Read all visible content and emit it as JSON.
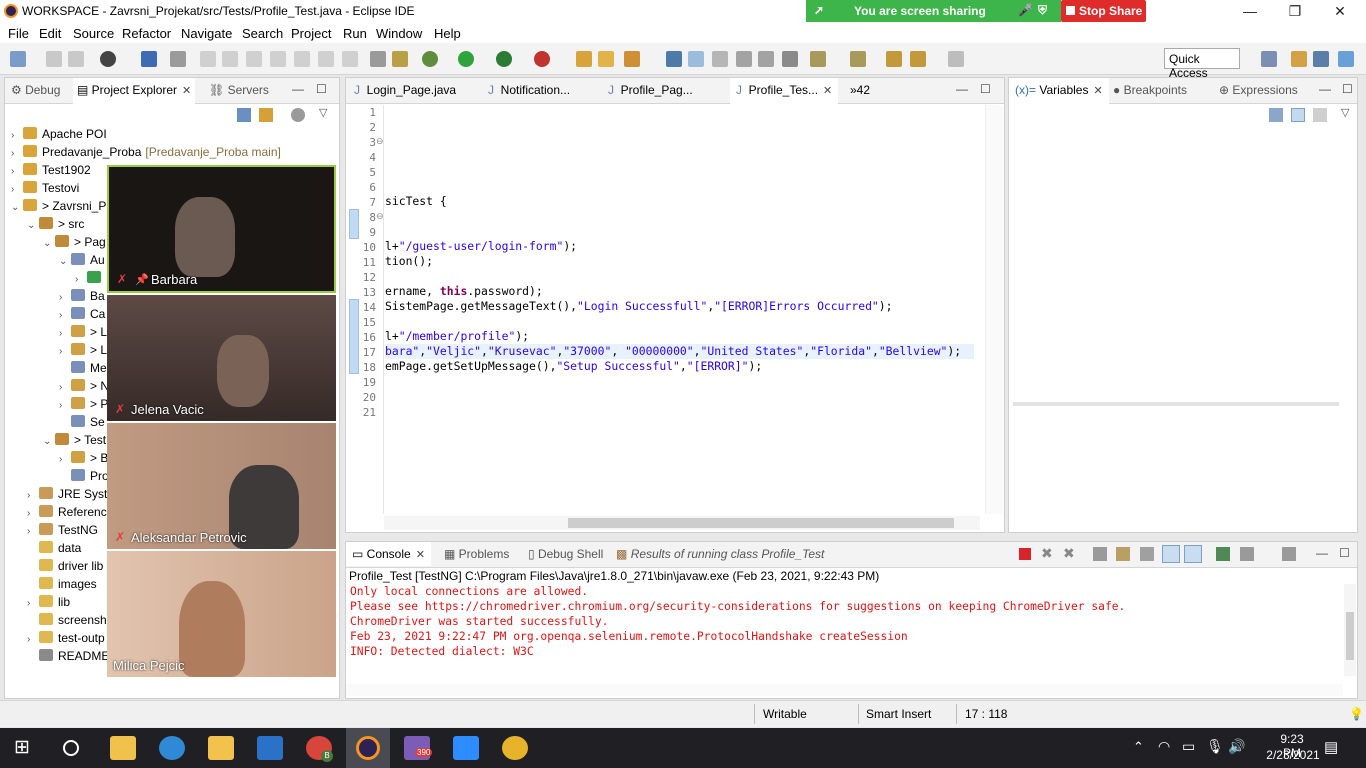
{
  "window": {
    "title": "WORKSPACE - Zavrsni_Projekat/src/Tests/Profile_Test.java - Eclipse IDE",
    "minimize": "—",
    "maximize": "❐",
    "close": "✕"
  },
  "screen_share": {
    "status": "You are screen sharing",
    "stop_label": "Stop Share",
    "color": "#3db54a",
    "stop_color": "#e02b2b"
  },
  "menu": [
    "File",
    "Edit",
    "Source",
    "Refactor",
    "Navigate",
    "Search",
    "Project",
    "Run",
    "Window",
    "Help"
  ],
  "toolbar": {
    "quick_access": "Quick Access"
  },
  "left_panel": {
    "tabs": [
      "Debug",
      "Project Explorer",
      "Servers"
    ],
    "active_tab": "Project Explorer",
    "tree": [
      {
        "label": "Apache POI",
        "arrow": "›",
        "branch": ""
      },
      {
        "label": "Predavanje_Proba",
        "arrow": "›",
        "branch": "[Predavanje_Proba main]"
      },
      {
        "label": "Test1902",
        "arrow": "›",
        "branch": ""
      },
      {
        "label": "Testovi",
        "arrow": "›",
        "branch": ""
      },
      {
        "label": "> Zavrsni_P",
        "arrow": "⌄",
        "branch": ""
      },
      {
        "label": "> src",
        "arrow": "⌄",
        "branch": ""
      },
      {
        "label": "> Pag",
        "arrow": "⌄",
        "branch": ""
      },
      {
        "label": "Au",
        "arrow": "⌄",
        "branch": ""
      },
      {
        "label": "",
        "arrow": "›",
        "branch": ""
      },
      {
        "label": "Ba",
        "arrow": "›",
        "branch": ""
      },
      {
        "label": "Ca",
        "arrow": "›",
        "branch": ""
      },
      {
        "label": "> L",
        "arrow": "›",
        "branch": ""
      },
      {
        "label": "> L",
        "arrow": "›",
        "branch": ""
      },
      {
        "label": "Me",
        "arrow": "",
        "branch": ""
      },
      {
        "label": "> N",
        "arrow": "›",
        "branch": ""
      },
      {
        "label": "> P",
        "arrow": "›",
        "branch": ""
      },
      {
        "label": "Se",
        "arrow": "",
        "branch": ""
      },
      {
        "label": "> Test",
        "arrow": "⌄",
        "branch": ""
      },
      {
        "label": "> B",
        "arrow": "›",
        "branch": ""
      },
      {
        "label": "Pro",
        "arrow": "",
        "branch": ""
      },
      {
        "label": "JRE Syste",
        "arrow": "›",
        "branch": ""
      },
      {
        "label": "Referenc",
        "arrow": "›",
        "branch": ""
      },
      {
        "label": "TestNG",
        "arrow": "›",
        "branch": ""
      },
      {
        "label": "data",
        "arrow": "",
        "branch": ""
      },
      {
        "label": "driver lib",
        "arrow": "",
        "branch": ""
      },
      {
        "label": "images",
        "arrow": "",
        "branch": ""
      },
      {
        "label": "lib",
        "arrow": "›",
        "branch": ""
      },
      {
        "label": "screensh",
        "arrow": "",
        "branch": ""
      },
      {
        "label": "test-outp",
        "arrow": "›",
        "branch": ""
      },
      {
        "label": "README",
        "arrow": "",
        "branch": ""
      }
    ]
  },
  "participants": [
    {
      "name": "Barbara",
      "mic": "✗",
      "pin": "📌",
      "bg": "#1a1614"
    },
    {
      "name": "Jelena Vacic",
      "mic": "✗",
      "pin": "",
      "bg": "#4a3a35"
    },
    {
      "name": "Aleksandar Petrovic",
      "mic": "✗",
      "pin": "",
      "bg": "#b08770"
    },
    {
      "name": "Milica Pejcic",
      "mic": "",
      "pin": "",
      "bg": "#d9b6a0"
    }
  ],
  "editor": {
    "tabs": [
      "Login_Page.java",
      "Notification...",
      "Profile_Pag...",
      "Profile_Tes..."
    ],
    "active_tab": "Profile_Tes...",
    "overflow_count": "»42",
    "line_numbers": [
      "1",
      "2",
      "3",
      "4",
      "5",
      "6",
      "7",
      "8",
      "9",
      "10",
      "11",
      "12",
      "13",
      "14",
      "15",
      "16",
      "17",
      "18",
      "19",
      "20",
      "21"
    ],
    "fold_markers": [
      "3",
      "8"
    ]
  },
  "right_panel": {
    "tabs": [
      "Variables",
      "Breakpoints",
      "Expressions"
    ],
    "active_tab": "Variables",
    "variables_prefix": "(x)="
  },
  "console": {
    "tabs": [
      "Console",
      "Problems",
      "Debug Shell",
      "Results of running class Profile_Test"
    ],
    "active_tab": "Console",
    "header": "Profile_Test [TestNG] C:\\Program Files\\Java\\jre1.8.0_271\\bin\\javaw.exe (Feb 23, 2021, 9:22:43 PM)",
    "lines": [
      "Only local connections are allowed.",
      "Please see https://chromedriver.chromium.org/security-considerations for suggestions on keeping ChromeDriver safe.",
      "ChromeDriver was started successfully.",
      "Feb 23, 2021 9:22:47 PM org.openqa.selenium.remote.ProtocolHandshake createSession",
      "INFO: Detected dialect: W3C"
    ]
  },
  "status": {
    "mode": "Writable",
    "insert": "Smart Insert",
    "position": "17 : 118"
  },
  "taskbar": {
    "time": "9:23 PM",
    "date": "2/23/2021",
    "badge": "390",
    "chrome_badge": "B"
  }
}
